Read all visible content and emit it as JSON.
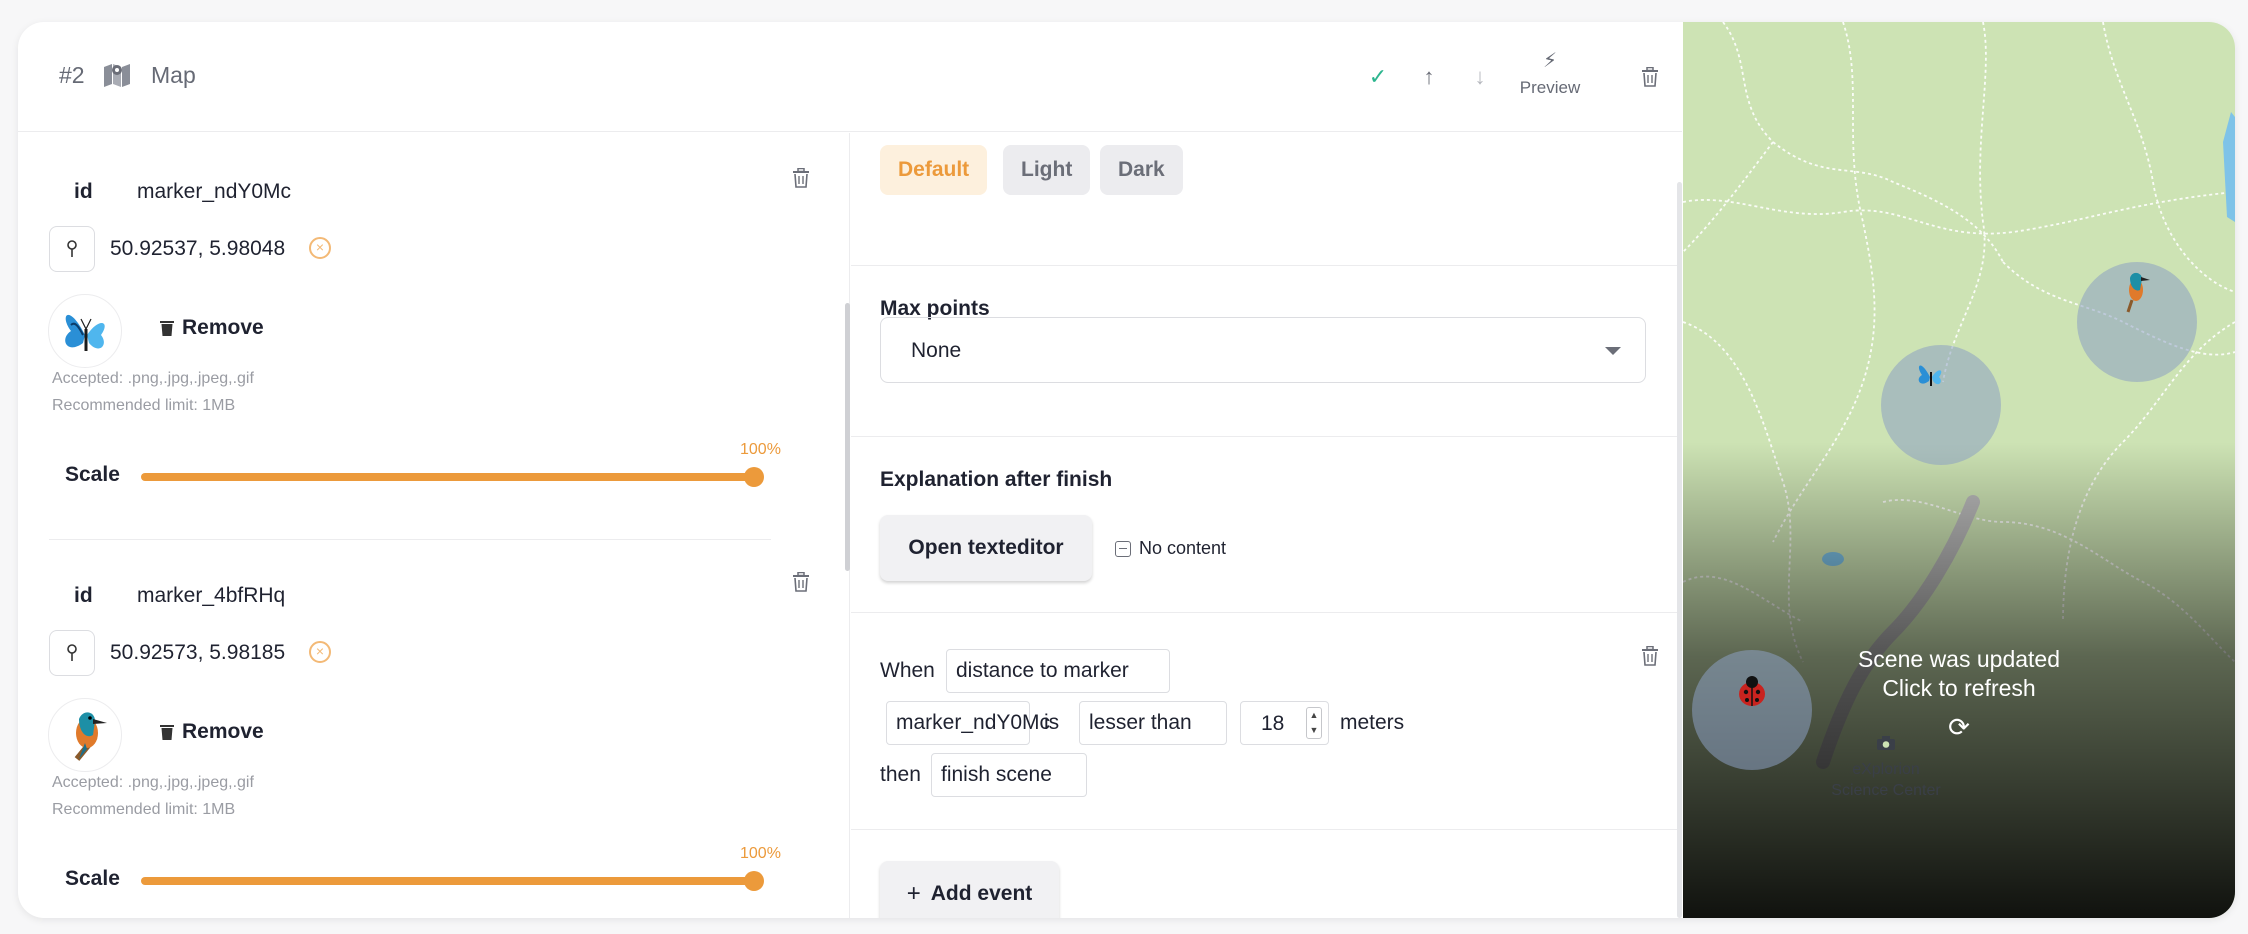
{
  "header": {
    "index": "#2",
    "title": "Map",
    "preview_label": "Preview"
  },
  "markers": [
    {
      "id_label": "id",
      "id": "marker_ndY0Mc",
      "coords": "50.92537, 5.98048",
      "image": "butterfly-image",
      "remove_label": "Remove",
      "accepted": "Accepted: .png,.jpg,.jpeg,.gif",
      "limit": "Recommended limit: 1MB",
      "scale_label": "Scale",
      "scale_percent": "100%",
      "scale_value": 1.0
    },
    {
      "id_label": "id",
      "id": "marker_4bfRHq",
      "coords": "50.92573, 5.98185",
      "image": "kingfisher-image",
      "remove_label": "Remove",
      "accepted": "Accepted: .png,.jpg,.jpeg,.gif",
      "limit": "Recommended limit: 1MB",
      "scale_label": "Scale",
      "scale_percent": "100%",
      "scale_value": 1.0
    }
  ],
  "themes": {
    "default": "Default",
    "light": "Light",
    "dark": "Dark",
    "selected": "Default"
  },
  "max_points": {
    "title": "Max points",
    "value": "None"
  },
  "explanation": {
    "title": "Explanation after finish",
    "button": "Open texteditor",
    "status": "No content"
  },
  "event": {
    "when": "When",
    "trigger": "distance to marker",
    "marker": "marker_ndY0Mc",
    "is": "is",
    "comparison": "lesser than",
    "distance": "18",
    "unit": "meters",
    "then": "then",
    "action": "finish scene"
  },
  "add_event": "Add event",
  "map": {
    "update_line1": "Scene was updated",
    "update_line2": "Click to refresh",
    "poi_label_1": "eXplorion",
    "poi_label_2": "Science Center"
  },
  "colors": {
    "accent": "#ec9a3b",
    "check": "#2cb58e",
    "map_green": "#cde3b4"
  }
}
